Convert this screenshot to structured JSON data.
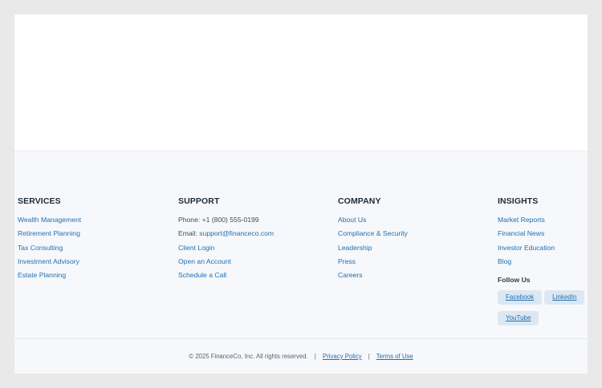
{
  "services": {
    "title": "SERVICES",
    "items": [
      "Wealth Management",
      "Retirement Planning",
      "Tax Consulting",
      "Investment Advisory",
      "Estate Planning"
    ]
  },
  "support": {
    "title": "SUPPORT",
    "phone_label": "Phone: +1 (800) 555-0199",
    "email_prefix": "Email: ",
    "email": "support@financeco.com",
    "links": [
      "Client Login",
      "Open an Account",
      "Schedule a Call"
    ]
  },
  "company": {
    "title": "COMPANY",
    "items": [
      "About Us",
      "Compliance & Security",
      "Leadership",
      "Press",
      "Careers"
    ]
  },
  "insights": {
    "title": "INSIGHTS",
    "items": [
      "Market Reports",
      "Financial News",
      "Investor Education",
      "Blog"
    ],
    "follow_title": "Follow Us",
    "social": [
      "Facebook",
      "LinkedIn",
      "YouTube"
    ]
  },
  "bottom": {
    "copyright": "© 2025 FinanceCo, Inc. All rights reserved.",
    "sep1": "|",
    "privacy": "Privacy Policy",
    "sep2": "|",
    "terms": "Terms of Use"
  },
  "colors": {
    "link": "#1f6fb2",
    "footer_bg": "#f6f8fb",
    "page_bg": "#e9e9e9"
  }
}
